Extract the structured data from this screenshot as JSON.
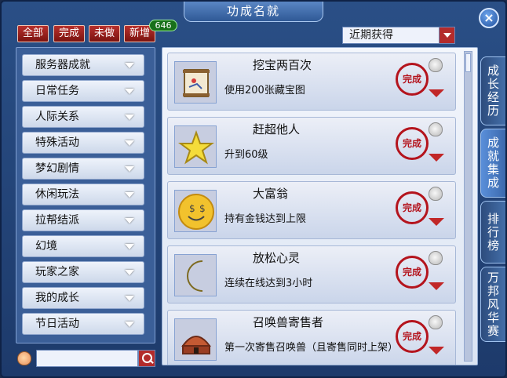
{
  "window": {
    "title": "功成名就"
  },
  "filters": [
    {
      "label": "全部"
    },
    {
      "label": "完成"
    },
    {
      "label": "未做"
    },
    {
      "label": "新增"
    }
  ],
  "badge": {
    "count": "646"
  },
  "sort": {
    "selected": "近期获得"
  },
  "categories": [
    {
      "label": "服务器成就"
    },
    {
      "label": "日常任务"
    },
    {
      "label": "人际关系"
    },
    {
      "label": "特殊活动"
    },
    {
      "label": "梦幻剧情"
    },
    {
      "label": "休闲玩法"
    },
    {
      "label": "拉帮结派"
    },
    {
      "label": "幻境"
    },
    {
      "label": "玩家之家"
    },
    {
      "label": "我的成长"
    },
    {
      "label": "节日活动"
    }
  ],
  "achievements": [
    {
      "title": "挖宝两百次",
      "desc": "使用200张藏宝图",
      "icon": "treasure-map-icon",
      "status": "完成"
    },
    {
      "title": "赶超他人",
      "desc": "升到60级",
      "icon": "star-icon",
      "status": "完成"
    },
    {
      "title": "大富翁",
      "desc": "持有金钱达到上限",
      "icon": "money-face-icon",
      "status": "完成"
    },
    {
      "title": "放松心灵",
      "desc": "连续在线达到3小时",
      "icon": "moon-icon",
      "status": "完成"
    },
    {
      "title": "召唤兽寄售者",
      "desc": "第一次寄售召唤兽（且寄售同时上架）",
      "icon": "yurt-icon",
      "status": "完成"
    }
  ],
  "side_tabs": [
    {
      "label": "成长经历"
    },
    {
      "label": "成就集成"
    },
    {
      "label": "排行榜"
    },
    {
      "label": "万邦风华赛"
    }
  ],
  "colors": {
    "accent": "#b4141d",
    "panel": "#2a4f86"
  }
}
